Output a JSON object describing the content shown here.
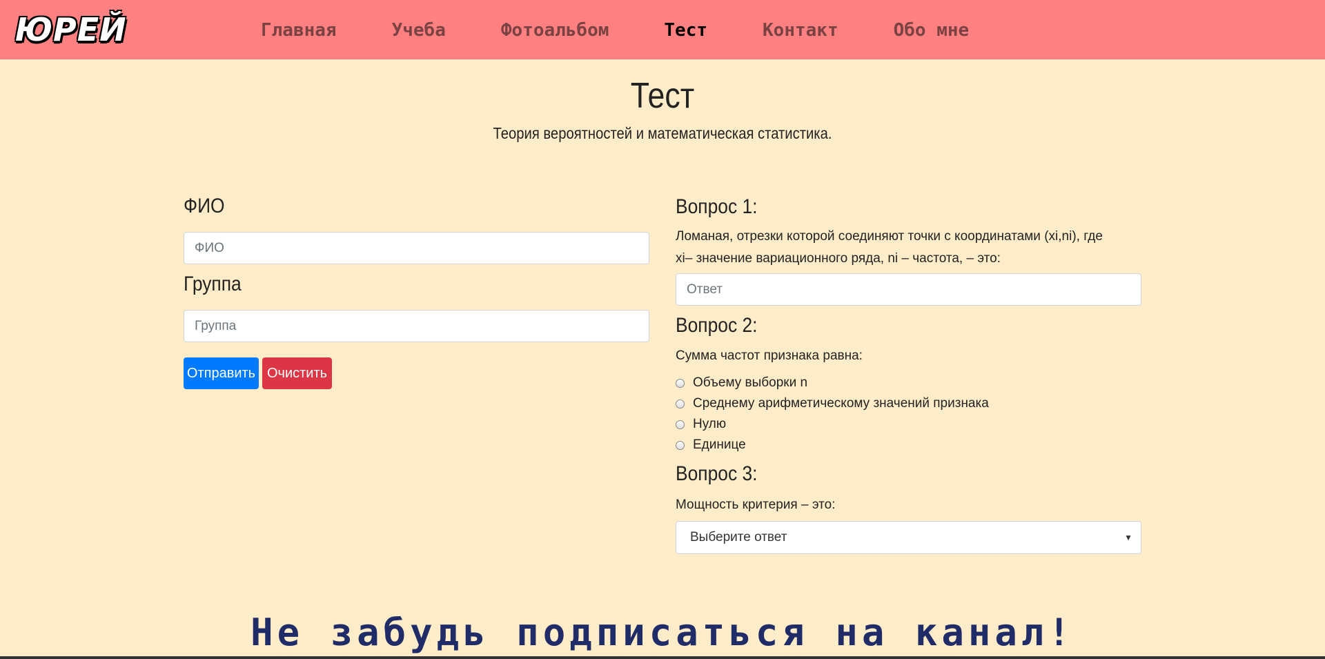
{
  "logo": "ЮРЕЙ",
  "nav": {
    "items": [
      {
        "label": "Главная"
      },
      {
        "label": "Учеба"
      },
      {
        "label": "Фотоальбом"
      },
      {
        "label": "Тест"
      },
      {
        "label": "Контакт"
      },
      {
        "label": "Обо мне"
      }
    ],
    "active": "Тест"
  },
  "page": {
    "title": "Тест",
    "subtitle": "Теория вероятностей и математическая статистика."
  },
  "form": {
    "fio_label": "ФИО",
    "fio_placeholder": "ФИО",
    "group_label": "Группа",
    "group_placeholder": "Группа",
    "submit_label": "Отправить",
    "clear_label": "Очистить"
  },
  "questions": {
    "q1": {
      "title": "Вопрос 1:",
      "text": "Ломаная, отрезки которой соединяют точки с координатами (xi,ni), где xi– значение вариационного ряда, ni – частота, – это:",
      "placeholder": "Ответ"
    },
    "q2": {
      "title": "Вопрос 2:",
      "text": "Сумма частот признака равна:",
      "options": [
        "Объему выборки n",
        "Среднему арифметическому значений признака",
        "Нулю",
        "Единице"
      ]
    },
    "q3": {
      "title": "Вопрос 3:",
      "text": "Мощность критерия – это:",
      "select_value": "Выберите ответ"
    }
  },
  "footer": {
    "banner": "Не забудь подписаться на канал!"
  },
  "colors": {
    "navbar": "#ff8080",
    "background": "#ffedc9",
    "primary": "#007bff",
    "danger": "#dc3545",
    "banner": "#1f2c68"
  }
}
